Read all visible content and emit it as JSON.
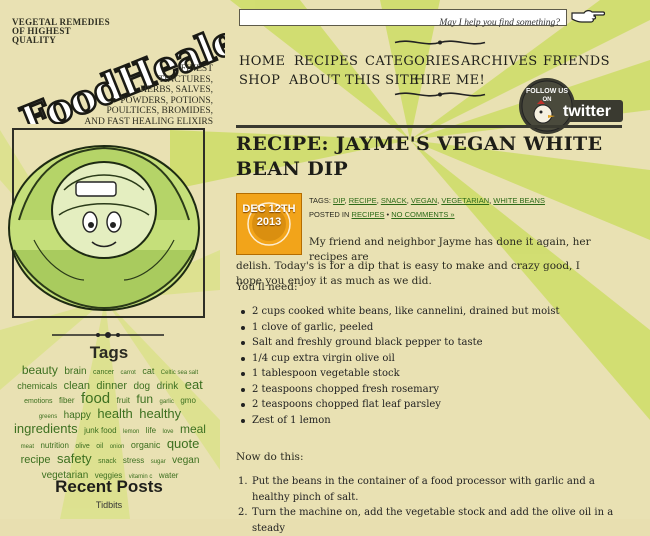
{
  "logo": {
    "tagline": "Vegetal Remedies of Highest Quality",
    "wordmark": "FoodHealer",
    "list": [
      "Finest",
      "Tinctures,",
      "Herbs, Salves,",
      "Powders, Potions,",
      "Poultices, Bromides,",
      "and Fast Healing Elixirs"
    ]
  },
  "search": {
    "placeholder": "May I help you find something?"
  },
  "nav": {
    "items": [
      "Home",
      "Recipes",
      "Categories",
      "Archives",
      "Friends",
      "Shop",
      "About This Site",
      "Hire Me!"
    ]
  },
  "twitter": {
    "top": "FOLLOW US",
    "on": "ON",
    "brand": "twitter"
  },
  "sidebar": {
    "tags_title": "Tags",
    "tags": [
      {
        "t": "beauty",
        "s": 12
      },
      {
        "t": "brain",
        "s": 10
      },
      {
        "t": "cancer",
        "s": 7
      },
      {
        "t": "carrot",
        "s": 6
      },
      {
        "t": "cat",
        "s": 9
      },
      {
        "t": "Celtic sea salt",
        "s": 6
      },
      {
        "t": "chemicals",
        "s": 9
      },
      {
        "t": "clean",
        "s": 11
      },
      {
        "t": "dinner",
        "s": 11
      },
      {
        "t": "dog",
        "s": 10
      },
      {
        "t": "drink",
        "s": 10
      },
      {
        "t": "eat",
        "s": 13
      },
      {
        "t": "emotions",
        "s": 7
      },
      {
        "t": "fiber",
        "s": 8
      },
      {
        "t": "food",
        "s": 15
      },
      {
        "t": "fruit",
        "s": 8
      },
      {
        "t": "fun",
        "s": 12
      },
      {
        "t": "garlic",
        "s": 6
      },
      {
        "t": "gmo",
        "s": 8
      },
      {
        "t": "greens",
        "s": 6
      },
      {
        "t": "happy",
        "s": 10
      },
      {
        "t": "health",
        "s": 13
      },
      {
        "t": "healthy",
        "s": 13
      },
      {
        "t": "ingredients",
        "s": 13
      },
      {
        "t": "junk food",
        "s": 8
      },
      {
        "t": "lemon",
        "s": 6
      },
      {
        "t": "life",
        "s": 8
      },
      {
        "t": "love",
        "s": 6
      },
      {
        "t": "meal",
        "s": 12
      },
      {
        "t": "meat",
        "s": 6
      },
      {
        "t": "nutrition",
        "s": 8
      },
      {
        "t": "olive",
        "s": 7
      },
      {
        "t": "oil",
        "s": 7
      },
      {
        "t": "onion",
        "s": 6
      },
      {
        "t": "organic",
        "s": 9
      },
      {
        "t": "quote",
        "s": 13
      },
      {
        "t": "recipe",
        "s": 11
      },
      {
        "t": "safety",
        "s": 13
      },
      {
        "t": "snack",
        "s": 7
      },
      {
        "t": "stress",
        "s": 8
      },
      {
        "t": "sugar",
        "s": 6
      },
      {
        "t": "vegan",
        "s": 10
      },
      {
        "t": "vegetarian",
        "s": 10
      },
      {
        "t": "veggies",
        "s": 8
      },
      {
        "t": "vitamin c",
        "s": 6
      },
      {
        "t": "water",
        "s": 8
      }
    ],
    "recent_title": "Recent Posts",
    "recent_items": [
      "Tidbits"
    ]
  },
  "post": {
    "title": "Recipe: Jayme's Vegan White Bean Dip",
    "date_line1": "DEC 12TH",
    "date_line2": "2013",
    "tags_label": "TAGS:",
    "tags": [
      "DIP",
      "RECIPE",
      "SNACK",
      "VEGAN",
      "VEGETARIAN",
      "WHITE BEANS"
    ],
    "posted_in_label": "POSTED IN",
    "category": "RECIPES",
    "comments": "NO COMMENTS »",
    "intro_a": "My friend and neighbor Jayme has done it again, her recipes are",
    "intro_b": "delish. Today's is for a dip that is easy to make and crazy good, I hope you enjoy it as much as we did.",
    "youll_need": "You'll need:",
    "ingredients": [
      "2 cups cooked white beans, like cannelini, drained but moist",
      "1 clove of  garlic, peeled",
      "Salt and freshly ground black pepper to taste",
      "1/4 cup extra virgin olive oil",
      "1 tablespoon vegetable stock",
      "2 teaspoons chopped fresh rosemary",
      "2 teaspoons chopped flat leaf parsley",
      "Zest of 1 lemon"
    ],
    "do_this": "Now do this:",
    "steps": [
      "Put the beans in the container of a food processor with garlic and a healthy pinch of salt.",
      "Turn the machine on, add the vegetable stock and add the olive oil in a steady"
    ]
  },
  "colors": {
    "background": "#e8dfb0",
    "ray": "#cfe06a",
    "link": "#3d7020",
    "badge": "#f2a41a"
  }
}
